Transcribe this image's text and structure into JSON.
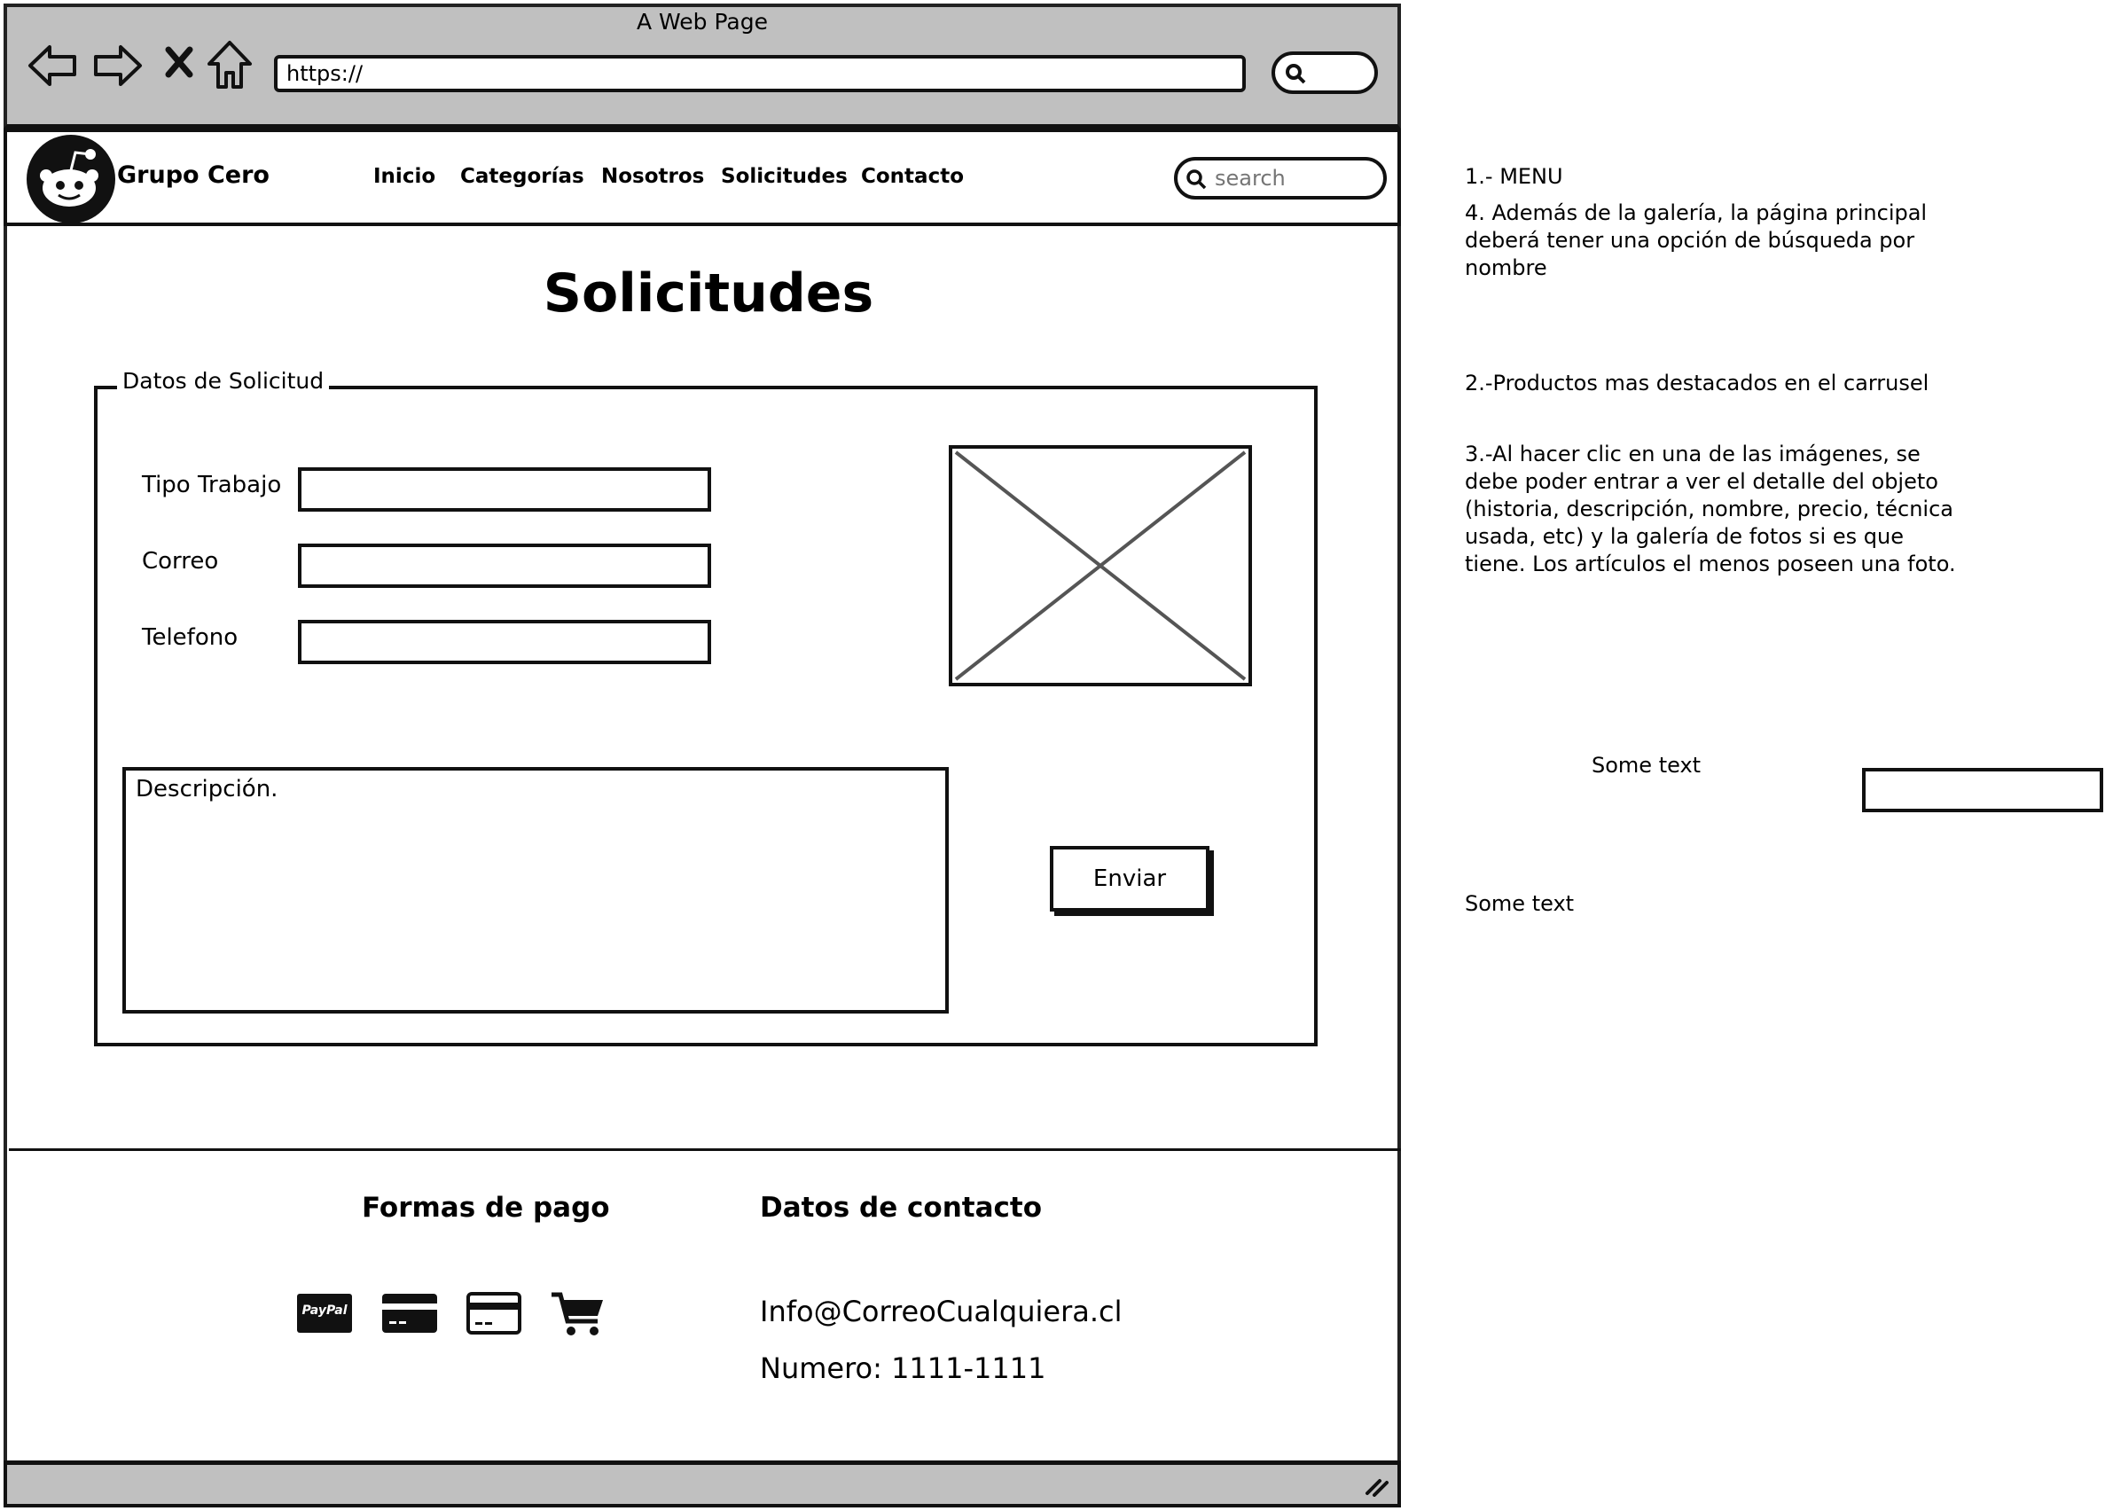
{
  "window": {
    "title": "A Web Page",
    "url": "https://"
  },
  "header": {
    "brand": "Grupo Cero",
    "nav": [
      "Inicio",
      "Categorías",
      "Nosotros",
      "Solicitudes",
      "Contacto"
    ],
    "search_placeholder": "search"
  },
  "main": {
    "title": "Solicitudes",
    "fieldset_legend": "Datos de Solicitud",
    "fields": [
      {
        "label": "Tipo Trabajo",
        "value": ""
      },
      {
        "label": "Correo",
        "value": ""
      },
      {
        "label": "Telefono",
        "value": ""
      }
    ],
    "description_placeholder": "Descripción.",
    "submit_label": "Enviar"
  },
  "footer": {
    "payments_heading": "Formas de pago",
    "payment_icons": [
      "paypal-icon",
      "credit-card-icon",
      "debit-card-icon",
      "shopping-cart-icon"
    ],
    "paypal_text": "PayPal",
    "contact_heading": "Datos de contacto",
    "email": "Info@CorreoCualquiera.cl",
    "phone": "Numero: 1111-1111"
  },
  "annotations": {
    "menu": "1.- MENU",
    "search_note": "4. Además de la galería, la página principal deberá tener una opción de búsqueda por nombre",
    "carousel_note": "2.-Productos mas destacados en el carrusel",
    "detail_note": "3.-Al hacer clic en una de las imágenes, se debe poder entrar a ver el detalle del objeto (historia, descripción, nombre, precio, técnica usada, etc) y la galería de fotos si es que tiene. Los artículos el menos poseen una foto.",
    "some_text_1": "Some text",
    "some_text_2": "Some text"
  }
}
